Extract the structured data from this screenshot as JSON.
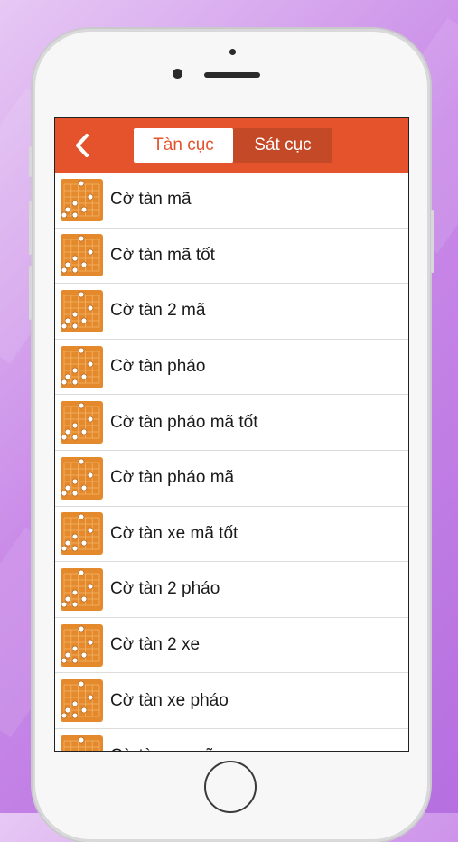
{
  "header": {
    "back_icon": "chevron-left-icon",
    "tabs": [
      {
        "label": "Tàn cục",
        "active": true
      },
      {
        "label": "Sát cục",
        "active": false
      }
    ]
  },
  "list": {
    "thumbnail_icon": "chess-board-icon",
    "items": [
      {
        "label": "Cờ tàn mã"
      },
      {
        "label": "Cờ tàn mã tốt"
      },
      {
        "label": "Cờ tàn 2 mã"
      },
      {
        "label": "Cờ tàn pháo"
      },
      {
        "label": "Cờ tàn pháo mã tốt"
      },
      {
        "label": "Cờ tàn pháo mã"
      },
      {
        "label": "Cờ tàn xe mã tốt"
      },
      {
        "label": "Cờ tàn 2 pháo"
      },
      {
        "label": "Cờ tàn 2 xe"
      },
      {
        "label": "Cờ tàn xe pháo"
      },
      {
        "label": "Cờ tàn xe mã"
      }
    ]
  },
  "colors": {
    "accent": "#e4532c",
    "segment_inactive": "#c44a27",
    "thumbnail": "#e48a2c"
  }
}
